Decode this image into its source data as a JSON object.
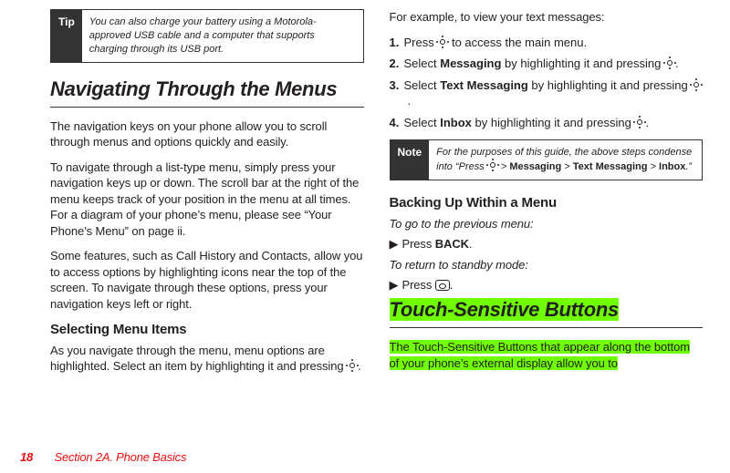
{
  "tip": {
    "label": "Tip",
    "text": "You can also charge your battery using a Motorola-approved USB cable and a computer that supports charging through its USB port."
  },
  "nav_section": {
    "title": "Navigating Through the Menus",
    "p1": "The navigation keys on your phone allow you to scroll through menus and options quickly and easily.",
    "p2": "To navigate through a list-type menu, simply press your navigation keys up or down. The scroll bar at the right of the menu keeps track of your position in the menu at all times. For a diagram of your phone’s menu, please see “Your Phone’s Menu” on page ii.",
    "p3": "Some features, such as Call History and Contacts, allow you to access options by highlighting icons near the top of the screen. To navigate through these options, press your navigation keys left or right.",
    "sub1_title": "Selecting Menu Items",
    "sub1_p_a": "As you navigate through the menu, menu options are highlighted. Select an item by highlighting it and pressing ",
    "sub1_p_b": "."
  },
  "example": {
    "intro": "For example, to view your text messages:",
    "steps": {
      "s1_a": "Press ",
      "s1_b": " to access the main menu.",
      "s2_a": "Select ",
      "s2_bold": "Messaging",
      "s2_b": " by highlighting it and pressing ",
      "s2_c": ".",
      "s3_a": "Select ",
      "s3_bold": "Text Messaging",
      "s3_b": " by highlighting it and pressing ",
      "s3_c": ".",
      "s4_a": "Select ",
      "s4_bold": "Inbox",
      "s4_b": " by highlighting it and pressing ",
      "s4_c": "."
    }
  },
  "note": {
    "label": "Note",
    "text_a": "For the purposes of this guide, the above steps condense into “Press ",
    "text_b": " > ",
    "bold1": "Messaging",
    "bold2": "Text Messaging",
    "bold3": "Inbox",
    "text_c": ".”"
  },
  "backing": {
    "title": "Backing Up Within a Menu",
    "line1_lead": "To go to the previous menu:",
    "line1_a": "Press ",
    "line1_bold": "BACK",
    "line1_b": ".",
    "line2_lead": "To return to standby mode:",
    "line2_a": "Press ",
    "line2_b": "."
  },
  "touch": {
    "title": "Touch-Sensitive Buttons",
    "p": "The Touch-Sensitive Buttons that appear along the bottom of your phone’s external display allow you to"
  },
  "footer": {
    "page_no": "18",
    "section": "Section 2A. Phone Basics"
  }
}
